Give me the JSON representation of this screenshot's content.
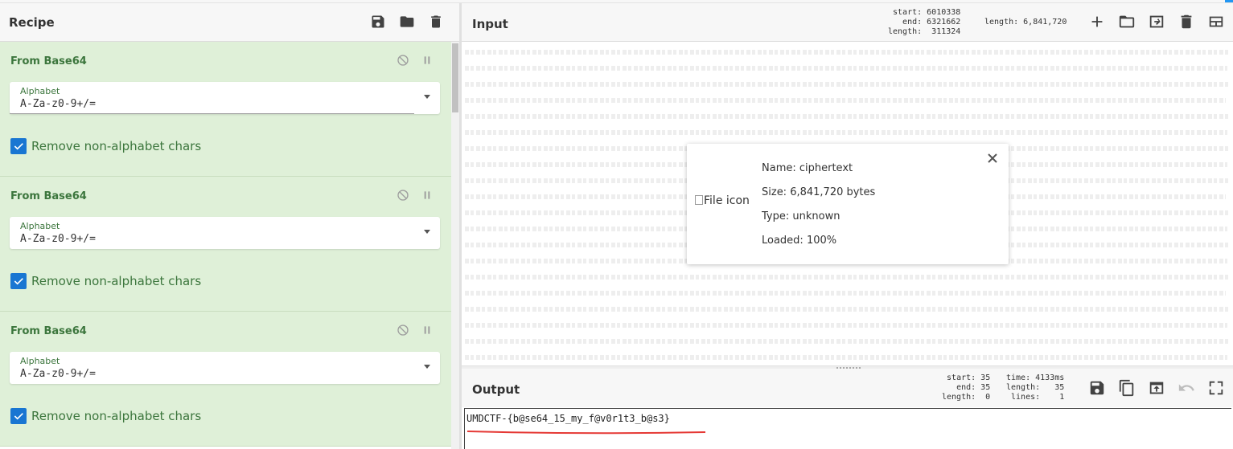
{
  "recipe": {
    "title": "Recipe",
    "icons": [
      "save-icon",
      "folder-icon",
      "trash-icon"
    ],
    "operations": [
      {
        "name": "From Base64",
        "alphabet_label": "Alphabet",
        "alphabet_value": "A-Za-z0-9+/=",
        "checkbox_label": "Remove non-alphabet chars",
        "checked": true
      },
      {
        "name": "From Base64",
        "alphabet_label": "Alphabet",
        "alphabet_value": "A-Za-z0-9+/=",
        "checkbox_label": "Remove non-alphabet chars",
        "checked": true
      },
      {
        "name": "From Base64",
        "alphabet_label": "Alphabet",
        "alphabet_value": "A-Za-z0-9+/=",
        "checkbox_label": "Remove non-alphabet chars",
        "checked": true
      }
    ]
  },
  "input": {
    "title": "Input",
    "info_selection": "start: 6010338\n  end: 6321662\nlength:  311324",
    "info_length": "length: 6,841,720",
    "icons": [
      "plus-icon",
      "folder-icon",
      "import-icon",
      "trash-icon",
      "layout-icon"
    ],
    "file": {
      "icon_alt": "File icon",
      "name": "Name: ciphertext",
      "size": "Size: 6,841,720 bytes",
      "type": "Type: unknown",
      "loaded": "Loaded: 100%"
    }
  },
  "output": {
    "title": "Output",
    "info_selection": "start: 35\n  end: 35\nlength:  0",
    "info_stats": "time: 4133ms\nlength:   35\n lines:    1",
    "icons": [
      "save-icon",
      "copy-icon",
      "open-in-input-icon",
      "undo-icon",
      "maximize-icon"
    ],
    "value": "UMDCTF-{b@se64_15_my_f@v0r1t3_b@s3}"
  },
  "colors": {
    "op_bg": "#dff0d8",
    "op_text": "#3c763d",
    "checkbox": "#1976d2",
    "annotation": "#e53935"
  }
}
